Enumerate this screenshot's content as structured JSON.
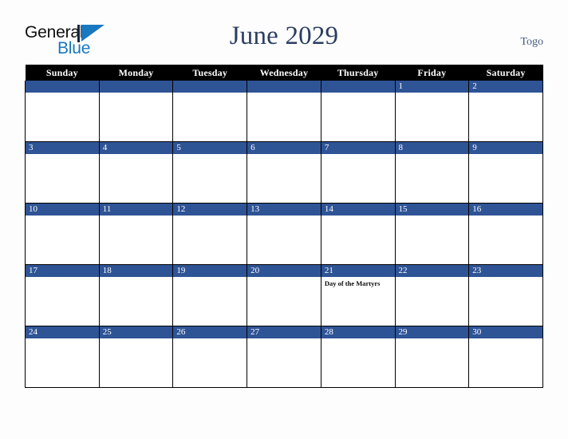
{
  "brand": {
    "name_part1": "General",
    "name_part2": "Blue",
    "triangle_icon": "blue-triangle-icon",
    "colors": {
      "dark_text": "#0f0f0f",
      "blue_text": "#1878c0",
      "triangle": "#1878c0"
    }
  },
  "header": {
    "title": "June 2029",
    "country": "Togo",
    "title_color": "#2b3e61",
    "country_color": "#46597f"
  },
  "calendar": {
    "weekday_headers": [
      "Sunday",
      "Monday",
      "Tuesday",
      "Wednesday",
      "Thursday",
      "Friday",
      "Saturday"
    ],
    "header_bg": "#000000",
    "header_text_color": "#ffffff",
    "daynum_bar_color": "#2f5496",
    "daynum_text_color": "#ffffff",
    "cell_bg": "#ffffff",
    "grid_line_color": "#000000",
    "weeks": [
      {
        "days": [
          {
            "number": "",
            "holiday": ""
          },
          {
            "number": "",
            "holiday": ""
          },
          {
            "number": "",
            "holiday": ""
          },
          {
            "number": "",
            "holiday": ""
          },
          {
            "number": "",
            "holiday": ""
          },
          {
            "number": "1",
            "holiday": ""
          },
          {
            "number": "2",
            "holiday": ""
          }
        ]
      },
      {
        "days": [
          {
            "number": "3",
            "holiday": ""
          },
          {
            "number": "4",
            "holiday": ""
          },
          {
            "number": "5",
            "holiday": ""
          },
          {
            "number": "6",
            "holiday": ""
          },
          {
            "number": "7",
            "holiday": ""
          },
          {
            "number": "8",
            "holiday": ""
          },
          {
            "number": "9",
            "holiday": ""
          }
        ]
      },
      {
        "days": [
          {
            "number": "10",
            "holiday": ""
          },
          {
            "number": "11",
            "holiday": ""
          },
          {
            "number": "12",
            "holiday": ""
          },
          {
            "number": "13",
            "holiday": ""
          },
          {
            "number": "14",
            "holiday": ""
          },
          {
            "number": "15",
            "holiday": ""
          },
          {
            "number": "16",
            "holiday": ""
          }
        ]
      },
      {
        "days": [
          {
            "number": "17",
            "holiday": ""
          },
          {
            "number": "18",
            "holiday": ""
          },
          {
            "number": "19",
            "holiday": ""
          },
          {
            "number": "20",
            "holiday": ""
          },
          {
            "number": "21",
            "holiday": "Day of the Martyrs"
          },
          {
            "number": "22",
            "holiday": ""
          },
          {
            "number": "23",
            "holiday": ""
          }
        ]
      },
      {
        "days": [
          {
            "number": "24",
            "holiday": ""
          },
          {
            "number": "25",
            "holiday": ""
          },
          {
            "number": "26",
            "holiday": ""
          },
          {
            "number": "27",
            "holiday": ""
          },
          {
            "number": "28",
            "holiday": ""
          },
          {
            "number": "29",
            "holiday": ""
          },
          {
            "number": "30",
            "holiday": ""
          }
        ]
      }
    ]
  }
}
